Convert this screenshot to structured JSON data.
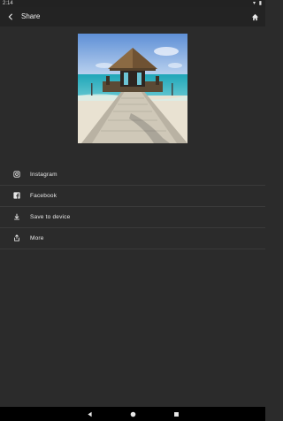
{
  "status_bar": {
    "time": "2:14",
    "right_glyphs": "▾ ▮"
  },
  "app_bar": {
    "title": "Share",
    "back_icon": "back-arrow-icon",
    "home_icon": "home-icon"
  },
  "preview": {
    "subject": "beach-hut-pier-photo"
  },
  "share_options": [
    {
      "label": "Instagram",
      "icon": "instagram-icon"
    },
    {
      "label": "Facebook",
      "icon": "facebook-icon"
    },
    {
      "label": "Save to device",
      "icon": "download-icon"
    },
    {
      "label": "More",
      "icon": "share-icon"
    }
  ],
  "nav_bar": {
    "back": "nav-back-icon",
    "home": "nav-home-icon",
    "recents": "nav-recents-icon"
  },
  "colors": {
    "background": "#2b2b2b",
    "app_bar": "#232323",
    "divider": "#3a3a3a",
    "text": "#eaeaea"
  }
}
